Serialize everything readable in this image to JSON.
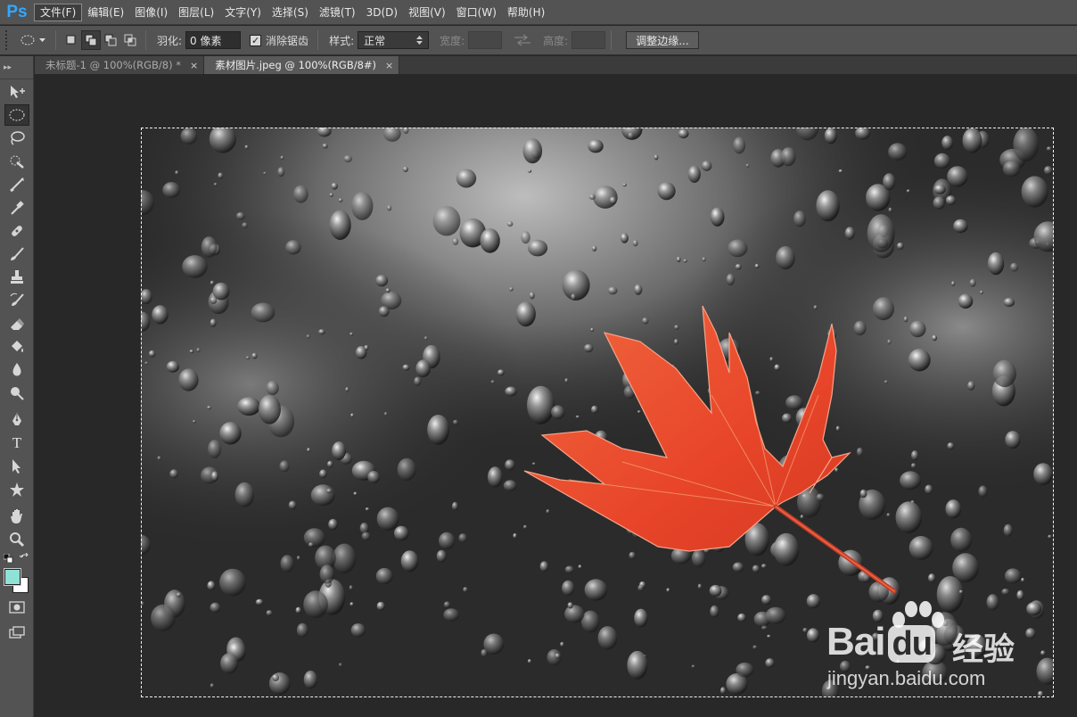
{
  "app": {
    "logo": "Ps",
    "menus": [
      "文件(F)",
      "编辑(E)",
      "图像(I)",
      "图层(L)",
      "文字(Y)",
      "选择(S)",
      "滤镜(T)",
      "3D(D)",
      "视图(V)",
      "窗口(W)",
      "帮助(H)"
    ],
    "active_menu_index": 0
  },
  "options_bar": {
    "feather_label": "羽化:",
    "feather_value": "0 像素",
    "antialias_label": "消除锯齿",
    "antialias_checked": true,
    "style_label": "样式:",
    "style_value": "正常",
    "width_label": "宽度:",
    "height_label": "高度:",
    "refine_edge_label": "调整边缘..."
  },
  "tabs": [
    {
      "title": "未标题-1 @ 100%(RGB/8) *",
      "close": "×",
      "active": false
    },
    {
      "title": "素材图片.jpeg @ 100%(RGB/8#)",
      "close": "×",
      "active": true
    }
  ],
  "tools": [
    "move-icon",
    "elliptical-marquee-icon",
    "lasso-icon",
    "quick-selection-icon",
    "crop-icon",
    "eyedropper-icon",
    "healing-brush-icon",
    "brush-icon",
    "clone-stamp-icon",
    "history-brush-icon",
    "eraser-icon",
    "paint-bucket-icon",
    "blur-icon",
    "dodge-icon",
    "pen-icon",
    "type-icon",
    "path-selection-icon",
    "custom-shape-icon",
    "hand-icon",
    "zoom-icon"
  ],
  "type_tool_glyph": "T",
  "colors": {
    "foreground": "#8fe3d6",
    "background": "#ffffff",
    "accent": "#31a8ff"
  },
  "watermark": {
    "brand_bai": "Bai",
    "brand_du": "du",
    "brand_cn": "经验",
    "url": "jingyan.baidu.com"
  }
}
